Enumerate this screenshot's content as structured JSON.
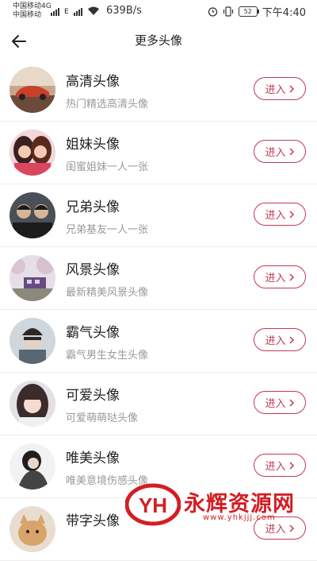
{
  "status_bar": {
    "carrier_1": "中国移动4G",
    "carrier_2": "中国移动",
    "network_type": "4G",
    "data_letter": "E",
    "net_speed": "639B/s",
    "battery": "52",
    "time": "下午4:40",
    "icons": [
      "signal-icon",
      "wifi-icon",
      "alarm-icon",
      "vibrate-icon",
      "battery-icon"
    ]
  },
  "nav": {
    "title": "更多头像",
    "back_icon": "back-arrow-icon"
  },
  "colors": {
    "accent": "#c33b4f",
    "title_text": "#222222",
    "subtitle_text": "#9a9a9a",
    "divider": "#eeeeee",
    "watermark": "#d21f24"
  },
  "items": [
    {
      "title": "高清头像",
      "subtitle": "热门精选高清头像",
      "button": "进入",
      "icon": "chevron-right-icon",
      "avatar": "car-avatar"
    },
    {
      "title": "姐妹头像",
      "subtitle": "闺蜜姐妹一人一张",
      "button": "进入",
      "icon": "chevron-right-icon",
      "avatar": "sisters-avatar"
    },
    {
      "title": "兄弟头像",
      "subtitle": "兄弟基友一人一张",
      "button": "进入",
      "icon": "chevron-right-icon",
      "avatar": "brothers-avatar"
    },
    {
      "title": "风景头像",
      "subtitle": "最新精美风景头像",
      "button": "进入",
      "icon": "chevron-right-icon",
      "avatar": "scenery-avatar"
    },
    {
      "title": "霸气头像",
      "subtitle": "霸气男生女生头像",
      "button": "进入",
      "icon": "chevron-right-icon",
      "avatar": "cool-avatar"
    },
    {
      "title": "可爱头像",
      "subtitle": "可爱萌萌哒头像",
      "button": "进入",
      "icon": "chevron-right-icon",
      "avatar": "cute-avatar"
    },
    {
      "title": "唯美头像",
      "subtitle": "唯美意境伤感头像",
      "button": "进入",
      "icon": "chevron-right-icon",
      "avatar": "aesthetic-avatar"
    },
    {
      "title": "带字头像",
      "subtitle": "",
      "button": "进入",
      "icon": "chevron-right-icon",
      "avatar": "text-avatar"
    }
  ],
  "watermark": {
    "logo": "YH",
    "name": "永辉资源网",
    "url": "www.yhkjjj.com"
  }
}
